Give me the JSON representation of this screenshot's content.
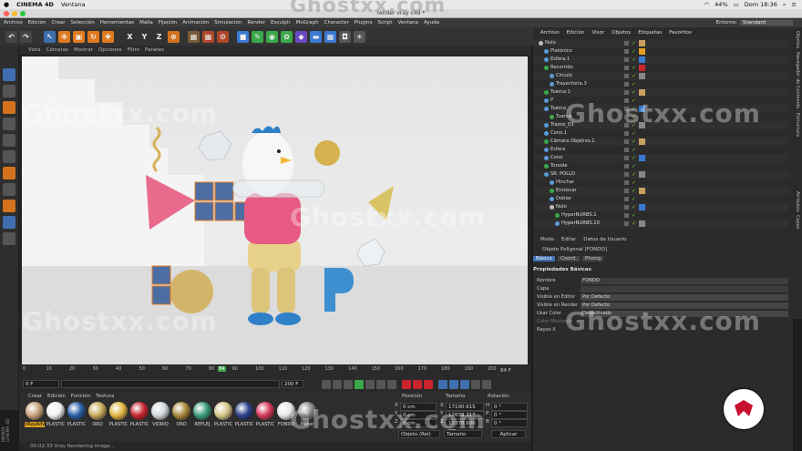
{
  "mac": {
    "app": "CINEMA 4D",
    "menu": "Ventana",
    "watermark_top": "Ghostxx.com",
    "battery": "44%",
    "clock": "Dom 18:36"
  },
  "window": {
    "title": "render vray c4d *"
  },
  "menubar": {
    "items": [
      "Archivo",
      "Edición",
      "Crear",
      "Selección",
      "Herramientas",
      "Malla",
      "Fijación",
      "Animación",
      "Simulación",
      "Render",
      "Esculpir",
      "MoGraph",
      "Character",
      "Plugins",
      "Script",
      "Ventana",
      "Ayuda"
    ],
    "layout_label": "Entorno:",
    "layout_value": "Standard"
  },
  "toolbar": {
    "axis_x": "X",
    "axis_y": "Y",
    "axis_z": "Z"
  },
  "viewport": {
    "menu": [
      "Vista",
      "Cámaras",
      "Mostrar",
      "Opciones",
      "Filtro",
      "Paneles"
    ]
  },
  "timeline": {
    "ticks": [
      "0",
      "10",
      "20",
      "30",
      "40",
      "50",
      "60",
      "70",
      "80",
      "84",
      "90",
      "100",
      "110",
      "120",
      "130",
      "140",
      "150",
      "160",
      "170",
      "180",
      "190",
      "200"
    ],
    "current_frame_marker": "84",
    "end_label": "84 F",
    "start_field": "0 F",
    "start_field2": "0 F",
    "end_field": "200 F",
    "end_field2": "200 F"
  },
  "materials": {
    "menu": [
      "Crear",
      "Edición",
      "Función",
      "Textura"
    ],
    "items": [
      {
        "label": "VRayAdv",
        "color": "#c9a17a"
      },
      {
        "label": "PLASTIC",
        "color": "#f2f2f2"
      },
      {
        "label": "PLASTIC",
        "color": "#2a5fa8"
      },
      {
        "label": "ORO",
        "color": "#c7a85a"
      },
      {
        "label": "PLASTIC",
        "color": "#e0b640"
      },
      {
        "label": "PLASTIC",
        "color": "#c8252f"
      },
      {
        "label": "VIDRIO",
        "color": "#cfd7dd"
      },
      {
        "label": "ORO",
        "color": "#a88a3c"
      },
      {
        "label": "REFLEJ",
        "color": "#3b9d7a"
      },
      {
        "label": "PLASTIC",
        "color": "#d6c68a"
      },
      {
        "label": "PLASTIC",
        "color": "#2c3f8a"
      },
      {
        "label": "PLASTIC",
        "color": "#d83a5a"
      },
      {
        "label": "FONDO",
        "color": "#e8e8e8"
      },
      {
        "label": "Mater",
        "color": "#888888"
      }
    ]
  },
  "coords": {
    "headers": [
      "Posición",
      "Tamaño",
      "Rotación"
    ],
    "rows": [
      {
        "axis": "X",
        "pos": "0 cm",
        "size": "17190.615 cm",
        "rlabel": "H",
        "rot": "0 °"
      },
      {
        "axis": "Y",
        "pos": "0 cm",
        "size": "12638.218 cm",
        "rlabel": "P",
        "rot": "0 °"
      },
      {
        "axis": "Z",
        "pos": "0 cm",
        "size": "12378.606 cm",
        "rlabel": "B",
        "rot": "0 °"
      }
    ],
    "mode1": "Objeto (Rel)",
    "mode2": "Tamaño",
    "apply": "Aplicar"
  },
  "status": "00:02:33 Vray Rendering image...",
  "objects": {
    "menu": [
      "Archivo",
      "Edición",
      "Visor",
      "Objetos",
      "Etiquetas",
      "Favoritos"
    ],
    "rows": [
      {
        "name": "Nulo",
        "indent": 0
      },
      {
        "name": "Platónico",
        "indent": 1
      },
      {
        "name": "Esfera.1",
        "indent": 1
      },
      {
        "name": "Recorrido",
        "indent": 1
      },
      {
        "name": "Círculo",
        "indent": 2
      },
      {
        "name": "Trayectoria.3",
        "indent": 2
      },
      {
        "name": "Tuerca.1",
        "indent": 1
      },
      {
        "name": "P",
        "indent": 1
      },
      {
        "name": "Tuerca",
        "indent": 1
      },
      {
        "name": "Tuerca",
        "indent": 2
      },
      {
        "name": "Trazos_03",
        "indent": 1
      },
      {
        "name": "Cono.1",
        "indent": 1
      },
      {
        "name": "Cámara Objetivo.1",
        "indent": 1
      },
      {
        "name": "Esfera",
        "indent": 1
      },
      {
        "name": "Cono",
        "indent": 1
      },
      {
        "name": "Toroide",
        "indent": 1
      },
      {
        "name": "SR. POLLO",
        "indent": 1
      },
      {
        "name": "Hinchar",
        "indent": 2
      },
      {
        "name": "Enroscar",
        "indent": 2
      },
      {
        "name": "Doblar",
        "indent": 2
      },
      {
        "name": "Nulo",
        "indent": 2
      },
      {
        "name": "HyperNURBS.1",
        "indent": 3
      },
      {
        "name": "HyperNURBS.10",
        "indent": 3
      }
    ]
  },
  "attributes": {
    "menu": [
      "Modo",
      "Editar",
      "Datos de Usuario"
    ],
    "object_title": "Objeto Poligonal [FONDO]",
    "tabs": [
      "Básico",
      "Coord.",
      "Phong"
    ],
    "section": "Propiedades Básicas",
    "fields": [
      {
        "label": "Nombre",
        "value": "FONDO"
      },
      {
        "label": "Capa",
        "value": ""
      },
      {
        "label": "Visible en Editor",
        "value": "Por Defecto"
      },
      {
        "label": "Visible en Render",
        "value": "Por Defecto"
      },
      {
        "label": "Usar Color",
        "value": "Desactivado"
      },
      {
        "label": "Color Mostrado",
        "value": ""
      },
      {
        "label": "Rayos X",
        "value": ""
      }
    ]
  },
  "right_strip": [
    "Objetos",
    "Navegador de Contenido",
    "Estructura"
  ],
  "right_strip2": [
    "Atributos",
    "Capas"
  ],
  "watermark": "Ghostxx.com",
  "maxon": "MAXON CINEMA 4D",
  "colors": {
    "accent_orange": "#e07a1f",
    "selection_blue": "#3f6fb0",
    "logo_red": "#c8102e"
  }
}
